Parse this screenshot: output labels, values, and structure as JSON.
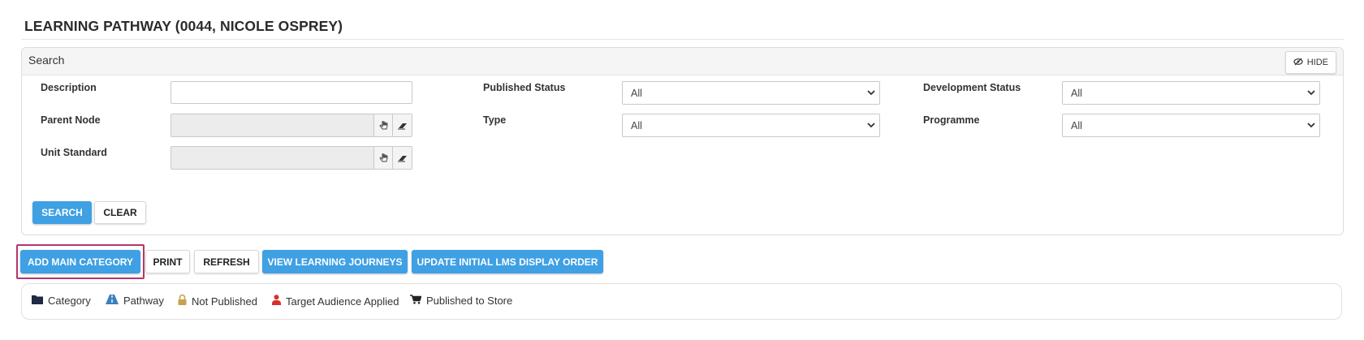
{
  "page": {
    "title": "LEARNING PATHWAY (0044, NICOLE OSPREY)"
  },
  "search": {
    "header": "Search",
    "hide_label": "HIDE",
    "fields": {
      "description": {
        "label": "Description",
        "value": ""
      },
      "parent_node": {
        "label": "Parent Node",
        "value": ""
      },
      "unit_standard": {
        "label": "Unit Standard",
        "value": ""
      },
      "published_status": {
        "label": "Published Status",
        "selected": "All"
      },
      "type": {
        "label": "Type",
        "selected": "All"
      },
      "development_status": {
        "label": "Development Status",
        "selected": "All"
      },
      "programme": {
        "label": "Programme",
        "selected": "All"
      }
    },
    "search_button": "SEARCH",
    "clear_button": "CLEAR"
  },
  "toolbar": {
    "add_main_category": "ADD MAIN CATEGORY",
    "print": "PRINT",
    "refresh": "REFRESH",
    "view_learning_journeys": "VIEW LEARNING JOURNEYS",
    "update_initial_lms_display_order": "UPDATE INITIAL LMS DISPLAY ORDER"
  },
  "legend": [
    {
      "icon": "folder-icon",
      "label": "Category"
    },
    {
      "icon": "road-icon",
      "label": "Pathway"
    },
    {
      "icon": "lock-icon",
      "label": "Not Published"
    },
    {
      "icon": "user-icon",
      "label": "Target Audience Applied"
    },
    {
      "icon": "cart-icon",
      "label": "Published to Store"
    }
  ],
  "colors": {
    "primary_button": "#3fa0e4",
    "highlight_border": "#b2376b",
    "lock_icon": "#c8a050",
    "user_icon": "#d9302c",
    "folder_icon": "#1f2a44"
  }
}
